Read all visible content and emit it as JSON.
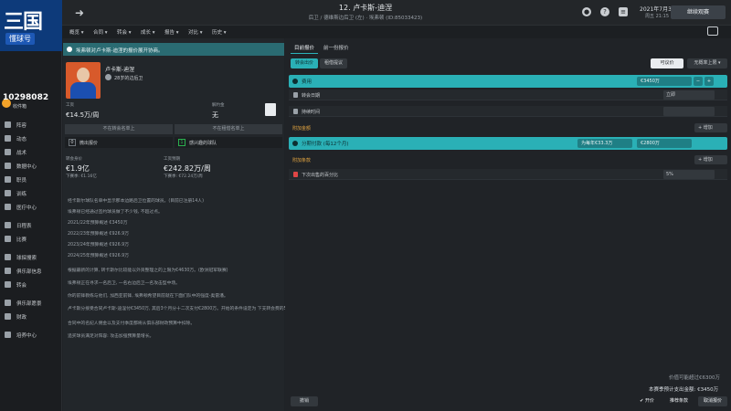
{
  "header": {
    "logo_text": "三国",
    "logo_sub": "懂球号",
    "player_title": "12. 卢卡斯-迪涅",
    "player_subtitle": "后卫 / 德维斯边后卫 (左) · 埃弗顿 (ID:85033423)",
    "date_main": "2021年7月3…",
    "date_sub": "周五 21:15",
    "continue_label": "继续观赛"
  },
  "menu": [
    "概览 ▾",
    "合同 ▾",
    "转会 ▾",
    "成长 ▾",
    "报告 ▾",
    "对比 ▾",
    "历史 ▾"
  ],
  "sidebar": {
    "club_id": "10298082",
    "club_sub": "收件箱",
    "items": [
      "阵容",
      "动态",
      "战术",
      "数据中心",
      "职员",
      "训练",
      "医疗中心",
      "日程表",
      "比赛",
      "球探搜索",
      "俱乐部信息",
      "转会",
      "俱乐部愿景",
      "财政",
      "培养中心"
    ]
  },
  "left": {
    "info_text": "埃弗顿对卢卡斯-迪涅的报价展开协商。",
    "player_name": "卢卡斯-迪涅",
    "player_age": "28岁的边后卫",
    "wage_label": "工资",
    "wage_value": "€14.5万/周",
    "release_label": "解约金",
    "release_value": "无",
    "list_btn_1": "不在转会名单上",
    "list_btn_2": "不在租借名单上",
    "row_a_num": "0",
    "row_a_label": "微出报价",
    "row_b_num": "1",
    "row_b_label": "感兴趣的球队",
    "stat1_label": "转会身价",
    "stat1_value": "€1.9亿",
    "stat1_sub": "下赛季: €1.16亿",
    "stat2_label": "工资预期",
    "stat2_value": "€242.82万/周",
    "stat2_sub": "下赛季: €72.24万/周",
    "news": [
      "经卡斯尔球队名单中显示那本边路后卫位置的球员。(目前已注册14人)",
      "埃弗顿已经通过签约球员做了不少钱, 不超过点。",
      "2021/22年预算概述 €3450万",
      "2022/23年预算概述 €926.9万",
      "2023/24年预算概述 €926.9万",
      "2024/25年预算概述 €926.9万",
      "根据最新的计算, 转卡斯尔比较能以外资整理之的上限为€4630万。(欧洲冠军联赛)",
      "埃弗顿正在寻求一名后卫, 一名右边后卫一名攻击型中场。",
      "你的前锋教练与他们, 加西亚前锋, 埃弗顿希望目前就在下面们队中的强度-奥雷潘。",
      "卢卡斯分接受合同卢卡斯-迪涅付€3450万, 其后3个月分十二次支付€2800万。开始的条件设定为 下支转会费的5%。",
      "合同中的名纪人佣金以及支付季度都将从俱乐部财政预算中扣除。",
      "追买球员满足对阵容: 攻击加强预算量增长。"
    ]
  },
  "right": {
    "tab1": "目前报价",
    "tab2": "前一份报价",
    "btn_bid": "转会出价",
    "btn_help": "租借提议",
    "btn_lock": "可议价",
    "btn_suggest": "无概率上限 ▾",
    "fee_label": "费用",
    "fee_value": "€3450万",
    "transfer_date_label": "转会日期",
    "transfer_date_value": "立即",
    "duration_label": "持续时间",
    "duration_value": "",
    "extra_fee_label": "附加金额",
    "add_label": "增加",
    "installment_label": "分期付款 (每12个月)",
    "installment_pill1": "为每年€33.3万",
    "installment_pill2": "€2800万",
    "extra_clause_label": "附加条款",
    "next_sale_label": "下次出售的百分比",
    "next_sale_value": "5%",
    "value_limit": "价值可能超过€6300万",
    "season_total": "本赛季预计支出金额: €3450万",
    "btn_open": "✔ 开价",
    "btn_recommend": "推荐条款",
    "btn_cancel": "取消报价",
    "bottom_left": "撤销"
  }
}
